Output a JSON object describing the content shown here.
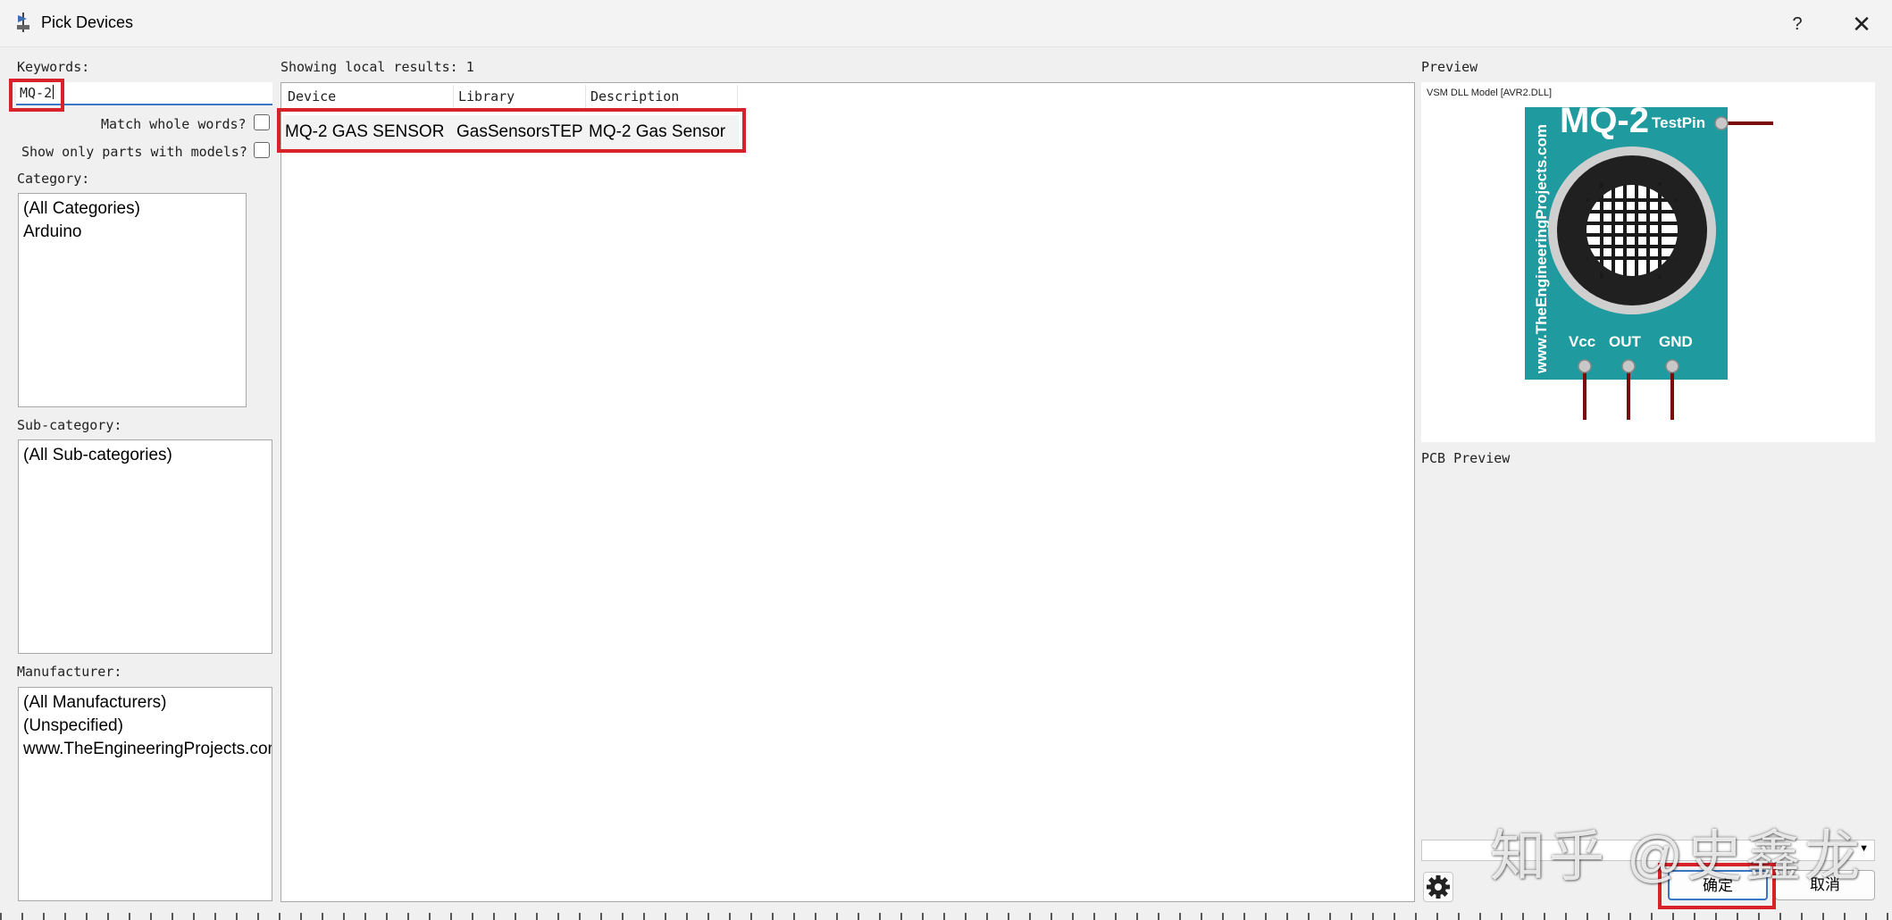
{
  "window": {
    "title": "Pick Devices",
    "help": "?",
    "close": "✕"
  },
  "keywords": {
    "label": "Keywords:",
    "value": "MQ-2"
  },
  "options": {
    "match_whole_words": {
      "label": "Match whole words?",
      "checked": false
    },
    "only_models": {
      "label": "Show only parts with models?",
      "checked": false
    }
  },
  "category": {
    "label": "Category:",
    "items": [
      "(All Categories)",
      "Arduino"
    ]
  },
  "subcategory": {
    "label": "Sub-category:",
    "items": [
      "(All Sub-categories)"
    ]
  },
  "manufacturer": {
    "label": "Manufacturer:",
    "items": [
      "(All Manufacturers)",
      "(Unspecified)",
      "www.TheEngineeringProjects.com"
    ]
  },
  "results": {
    "label": "Showing local results: 1",
    "columns": [
      "Device",
      "Library",
      "Description"
    ],
    "rows": [
      {
        "device": "MQ-2 GAS SENSOR",
        "library": "GasSensorsTEP",
        "description": "MQ-2 Gas Sensor"
      }
    ]
  },
  "preview": {
    "label": "Preview",
    "model_caption": "VSM DLL Model [AVR2.DLL]",
    "sensor": {
      "name": "MQ-2",
      "side_text": "www.TheEngineeringProjects.com",
      "testpin": "TestPin",
      "pins": [
        "Vcc",
        "OUT",
        "GND"
      ],
      "board_color": "#1f9a9f",
      "pin_wire_color": "#7a0c0c"
    }
  },
  "pcb_preview": {
    "label": "PCB Preview"
  },
  "buttons": {
    "ok": "确定",
    "cancel": "取消",
    "settings": "gear-icon"
  },
  "watermark": "知乎 @史鑫龙",
  "highlight_color": "#d8222a"
}
